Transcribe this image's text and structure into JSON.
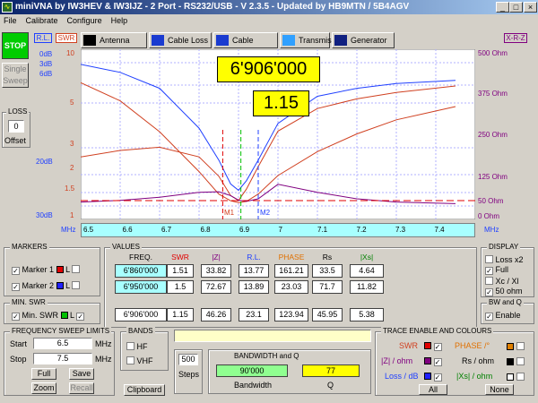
{
  "window": {
    "title": "miniVNA by IW3HEV & IW3IJZ - 2 Port - RS232/USB - V 2.3.5 - Updated by HB9MTN / 5B4AGV",
    "min": "_",
    "max": "□",
    "close": "×"
  },
  "menu": [
    "File",
    "Calibrate",
    "Configure",
    "Help"
  ],
  "left": {
    "stop": "STOP",
    "single_sweep": "Single Sweep",
    "loss_title": "LOSS",
    "loss_value": "0",
    "offset": "Offset"
  },
  "rl_label": "R.L.",
  "swr_label": "SWR",
  "xrz_label": "X-R-Z",
  "tabs": [
    "Antenna",
    "Cable Loss",
    "Cable Length",
    "Transmission",
    "Generator"
  ],
  "db_labels": [
    "0dB",
    "3dB",
    "6dB",
    "20dB",
    "30dB"
  ],
  "swr_labels": [
    "10",
    "5",
    "3",
    "2",
    "1.5",
    "1"
  ],
  "ohm_labels": [
    "500 Ohm",
    "375 Ohm",
    "250 Ohm",
    "125 Ohm",
    "50 Ohm",
    "0 Ohm"
  ],
  "mhz": "MHz",
  "x_ticks": [
    "6.5",
    "6.6",
    "6.7",
    "6.8",
    "6.9",
    "7",
    "7.1",
    "7.2",
    "7.3",
    "7.4"
  ],
  "freq_readout": "6'906'000",
  "swr_readout": "1.15",
  "m1": "M1",
  "m2": "M2",
  "chart_data": {
    "type": "line",
    "x": [
      6.5,
      6.6,
      6.7,
      6.8,
      6.85,
      6.88,
      6.9,
      6.92,
      6.95,
      7.0,
      7.1,
      7.2,
      7.3,
      7.45
    ],
    "series": [
      {
        "values": [
          9.5,
          9.0,
          8.0,
          5.5,
          3.5,
          2.0,
          1.6,
          2.2,
          3.5,
          5.8,
          7.5,
          8.0,
          8.3,
          8.5
        ]
      },
      {
        "values": [
          6.5,
          5.0,
          3.2,
          1.8,
          1.3,
          1.18,
          1.15,
          1.17,
          1.3,
          1.7,
          2.4,
          3.1,
          3.8,
          4.6
        ]
      },
      {
        "values": [
          180,
          200,
          210,
          180,
          120,
          60,
          45,
          80,
          150,
          260,
          330,
          360,
          380,
          400
        ]
      },
      {
        "values": [
          40,
          45,
          55,
          70,
          72,
          60,
          46,
          42,
          50,
          95,
          70,
          50,
          40,
          35
        ]
      }
    ],
    "xlim": [
      6.5,
      7.5
    ]
  },
  "markers": {
    "title": "MARKERS",
    "m1": "Marker 1",
    "m2": "Marker 2",
    "L": "L"
  },
  "minswr": {
    "title": "MIN. SWR",
    "label": "Min. SWR",
    "L": "L"
  },
  "values": {
    "title": "VALUES",
    "headers": [
      "FREQ.",
      "SWR",
      "|Z|",
      "R.L.",
      "PHASE",
      "Rs",
      "|Xs|"
    ],
    "rows": [
      [
        "6'860'000",
        "1.51",
        "33.82",
        "13.77",
        "161.21",
        "33.5",
        "4.64"
      ],
      [
        "6'950'000",
        "1.5",
        "72.67",
        "13.89",
        "23.03",
        "71.7",
        "11.82"
      ],
      [
        "6'906'000",
        "1.15",
        "46.26",
        "23.1",
        "123.94",
        "45.95",
        "5.38"
      ]
    ]
  },
  "display": {
    "title": "DISPLAY",
    "loss_x2": "Loss x2",
    "full": "Full",
    "xc": "Xc / Xl",
    "ohm50": "50 ohm"
  },
  "bwq": {
    "title": "BW and Q",
    "enable": "Enable"
  },
  "sweep": {
    "title": "FREQUENCY SWEEP LIMITS",
    "start": "Start",
    "start_val": "6.5",
    "stop": "Stop",
    "stop_val": "7.5",
    "mhz": "MHz",
    "full": "Full",
    "save": "Save",
    "zoom": "Zoom",
    "recall": "Recall"
  },
  "bands": {
    "title": "BANDS",
    "hf": "HF",
    "vhf": "VHF"
  },
  "clipboard": "Clipboard",
  "steps": {
    "value": "500",
    "label": "Steps"
  },
  "bandwidth": {
    "title": "BANDWIDTH and Q",
    "bw_val": "90'000",
    "q_val": "77",
    "bw_lbl": "Bandwidth",
    "q_lbl": "Q"
  },
  "trace": {
    "title": "TRACE ENABLE AND COLOURS",
    "swr": "SWR",
    "phase": "PHASE /°",
    "z": "|Z| / ohm",
    "rs": "Rs / ohm",
    "loss": "Loss / dB",
    "xs": "|Xs| / ohm",
    "all": "All",
    "none": "None"
  }
}
